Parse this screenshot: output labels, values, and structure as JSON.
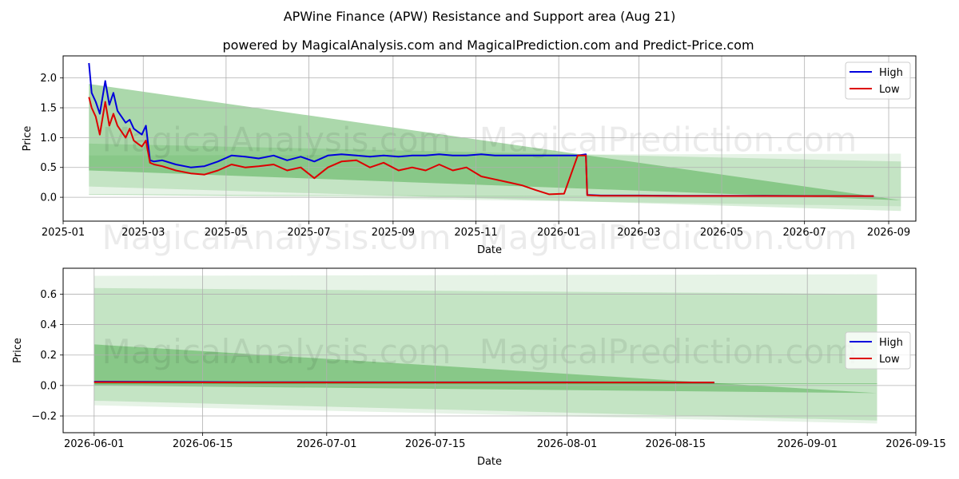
{
  "title": "APWine Finance (APW) Resistance and Support area (Aug 21)",
  "subtitle": "powered by MagicalAnalysis.com and MagicalPrediction.com and Predict-Price.com",
  "watermarks": [
    "MagicalAnalysis.com",
    "MagicalPrediction.com"
  ],
  "colors": {
    "high": "#0000dd",
    "low": "#dd0000",
    "band": "#2e9e2e"
  },
  "chart_data": [
    {
      "type": "line",
      "xlabel": "Date",
      "ylabel": "Price",
      "xlim": [
        "2025-01-01",
        "2026-09-21"
      ],
      "ylim": [
        -0.4,
        2.37
      ],
      "x_ticks": [
        "2025-01",
        "2025-03",
        "2025-05",
        "2025-07",
        "2025-09",
        "2025-11",
        "2026-01",
        "2026-03",
        "2026-05",
        "2026-07",
        "2026-09"
      ],
      "y_ticks": [
        0.0,
        0.5,
        1.0,
        1.5,
        2.0
      ],
      "grid": true,
      "legend": "top-right",
      "series": [
        {
          "name": "High",
          "x": [
            "2025-01-20",
            "2025-01-22",
            "2025-01-25",
            "2025-01-28",
            "2025-02-01",
            "2025-02-04",
            "2025-02-07",
            "2025-02-10",
            "2025-02-13",
            "2025-02-16",
            "2025-02-19",
            "2025-02-22",
            "2025-02-25",
            "2025-02-28",
            "2025-03-03",
            "2025-03-06",
            "2025-03-09",
            "2025-03-15",
            "2025-03-25",
            "2025-04-05",
            "2025-04-15",
            "2025-04-25",
            "2025-05-05",
            "2025-05-15",
            "2025-05-25",
            "2025-06-05",
            "2025-06-15",
            "2025-06-25",
            "2025-07-05",
            "2025-07-15",
            "2025-07-25",
            "2025-08-05",
            "2025-08-15",
            "2025-08-25",
            "2025-09-05",
            "2025-09-15",
            "2025-09-25",
            "2025-10-05",
            "2025-10-15",
            "2025-10-25",
            "2025-11-05",
            "2025-11-15",
            "2025-11-25",
            "2025-12-05",
            "2025-12-15",
            "2025-12-25",
            "2026-01-05",
            "2026-01-15",
            "2026-01-21",
            "2026-01-22",
            "2026-02-01",
            "2026-03-01",
            "2026-04-01",
            "2026-05-01",
            "2026-06-01",
            "2026-07-01",
            "2026-08-01",
            "2026-08-21"
          ],
          "values": [
            2.25,
            1.75,
            1.6,
            1.4,
            1.95,
            1.55,
            1.75,
            1.45,
            1.35,
            1.25,
            1.3,
            1.15,
            1.1,
            1.05,
            1.2,
            0.62,
            0.6,
            0.62,
            0.55,
            0.5,
            0.52,
            0.6,
            0.7,
            0.68,
            0.65,
            0.7,
            0.62,
            0.68,
            0.6,
            0.7,
            0.72,
            0.7,
            0.68,
            0.7,
            0.68,
            0.7,
            0.7,
            0.72,
            0.7,
            0.7,
            0.72,
            0.7,
            0.7,
            0.7,
            0.7,
            0.7,
            0.7,
            0.7,
            0.72,
            0.04,
            0.03,
            0.03,
            0.025,
            0.025,
            0.025,
            0.022,
            0.021,
            0.02
          ]
        },
        {
          "name": "Low",
          "x": [
            "2025-01-20",
            "2025-01-22",
            "2025-01-25",
            "2025-01-28",
            "2025-02-01",
            "2025-02-04",
            "2025-02-07",
            "2025-02-10",
            "2025-02-13",
            "2025-02-16",
            "2025-02-19",
            "2025-02-22",
            "2025-02-25",
            "2025-02-28",
            "2025-03-03",
            "2025-03-06",
            "2025-03-09",
            "2025-03-15",
            "2025-03-25",
            "2025-04-05",
            "2025-04-15",
            "2025-04-25",
            "2025-05-05",
            "2025-05-15",
            "2025-05-25",
            "2025-06-05",
            "2025-06-15",
            "2025-06-25",
            "2025-07-05",
            "2025-07-15",
            "2025-07-25",
            "2025-08-05",
            "2025-08-15",
            "2025-08-25",
            "2025-09-05",
            "2025-09-15",
            "2025-09-25",
            "2025-10-05",
            "2025-10-15",
            "2025-10-25",
            "2025-11-05",
            "2025-11-15",
            "2025-11-25",
            "2025-12-05",
            "2025-12-15",
            "2025-12-25",
            "2026-01-05",
            "2026-01-15",
            "2026-01-21",
            "2026-01-22",
            "2026-02-01",
            "2026-03-01",
            "2026-04-01",
            "2026-05-01",
            "2026-06-01",
            "2026-07-01",
            "2026-08-01",
            "2026-08-21"
          ],
          "values": [
            1.68,
            1.5,
            1.35,
            1.05,
            1.6,
            1.2,
            1.4,
            1.2,
            1.1,
            1.0,
            1.15,
            0.95,
            0.9,
            0.85,
            0.95,
            0.58,
            0.55,
            0.52,
            0.45,
            0.4,
            0.38,
            0.45,
            0.55,
            0.5,
            0.52,
            0.55,
            0.45,
            0.5,
            0.32,
            0.5,
            0.6,
            0.62,
            0.5,
            0.58,
            0.45,
            0.5,
            0.45,
            0.55,
            0.45,
            0.5,
            0.35,
            0.3,
            0.25,
            0.2,
            0.12,
            0.05,
            0.06,
            0.7,
            0.7,
            0.035,
            0.025,
            0.025,
            0.022,
            0.022,
            0.022,
            0.02,
            0.02,
            0.02
          ]
        }
      ],
      "bands": [
        {
          "x": [
            "2025-01-20",
            "2026-09-10"
          ],
          "upper": [
            1.9,
            -0.05
          ],
          "lower": [
            0.45,
            -0.05
          ]
        },
        {
          "x": [
            "2025-01-20",
            "2026-09-10"
          ],
          "upper": [
            0.9,
            0.6
          ],
          "lower": [
            0.18,
            -0.23
          ]
        },
        {
          "x": [
            "2025-01-20",
            "2026-09-10"
          ],
          "upper": [
            0.7,
            0.73
          ],
          "lower": [
            0.05,
            -0.15
          ]
        },
        {
          "x": [
            "2025-01-20",
            "2026-09-10"
          ],
          "upper": [
            0.05,
            0.0
          ],
          "lower": [
            0.04,
            0.0
          ]
        }
      ]
    },
    {
      "type": "line",
      "xlabel": "Date",
      "ylabel": "Price",
      "xlim": [
        "2026-05-28",
        "2026-09-15"
      ],
      "ylim": [
        -0.31,
        0.77
      ],
      "x_ticks": [
        "2026-06-01",
        "2026-06-15",
        "2026-07-01",
        "2026-07-15",
        "2026-08-01",
        "2026-08-15",
        "2026-09-01",
        "2026-09-15"
      ],
      "y_ticks": [
        -0.2,
        0.0,
        0.2,
        0.4,
        0.6
      ],
      "grid": true,
      "legend": "center-right",
      "series": [
        {
          "name": "High",
          "x": [
            "2026-06-01",
            "2026-06-20",
            "2026-07-10",
            "2026-08-01",
            "2026-08-20"
          ],
          "values": [
            0.025,
            0.022,
            0.021,
            0.021,
            0.02
          ]
        },
        {
          "name": "Low",
          "x": [
            "2026-06-01",
            "2026-06-20",
            "2026-07-10",
            "2026-08-01",
            "2026-08-20"
          ],
          "values": [
            0.022,
            0.02,
            0.02,
            0.02,
            0.02
          ]
        }
      ],
      "bands": [
        {
          "x": [
            "2026-06-01",
            "2026-09-10"
          ],
          "upper": [
            0.27,
            -0.05
          ],
          "lower": [
            0.0,
            -0.05
          ]
        },
        {
          "x": [
            "2026-06-01",
            "2026-09-10"
          ],
          "upper": [
            0.64,
            0.6
          ],
          "lower": [
            -0.1,
            -0.23
          ]
        },
        {
          "x": [
            "2026-06-01",
            "2026-09-10"
          ],
          "upper": [
            0.72,
            0.73
          ],
          "lower": [
            -0.13,
            -0.25
          ]
        },
        {
          "x": [
            "2026-06-01",
            "2026-09-10"
          ],
          "upper": [
            0.015,
            0.015
          ],
          "lower": [
            0.01,
            0.01
          ]
        }
      ]
    }
  ]
}
